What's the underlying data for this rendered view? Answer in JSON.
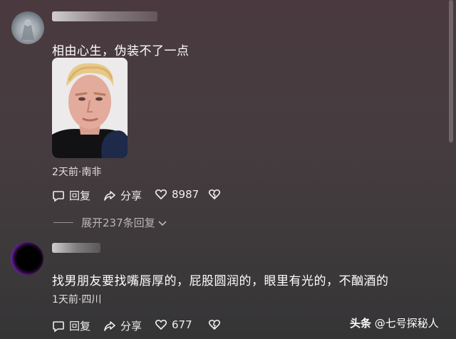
{
  "comments": [
    {
      "text": "相由心生，伪装不了一点",
      "meta": "2天前·南非",
      "actions": {
        "reply": "回复",
        "share": "分享",
        "likes": "8987"
      },
      "expand_label": "展开237条回复"
    },
    {
      "text": "找男朋友要找嘴唇厚的，屁股圆润的，眼里有光的，不酗酒的",
      "meta": "1天前·四川",
      "actions": {
        "reply": "回复",
        "share": "分享",
        "likes": "677"
      }
    }
  ],
  "watermark": {
    "brand": "头条",
    "handle": "@七号探秘人"
  }
}
